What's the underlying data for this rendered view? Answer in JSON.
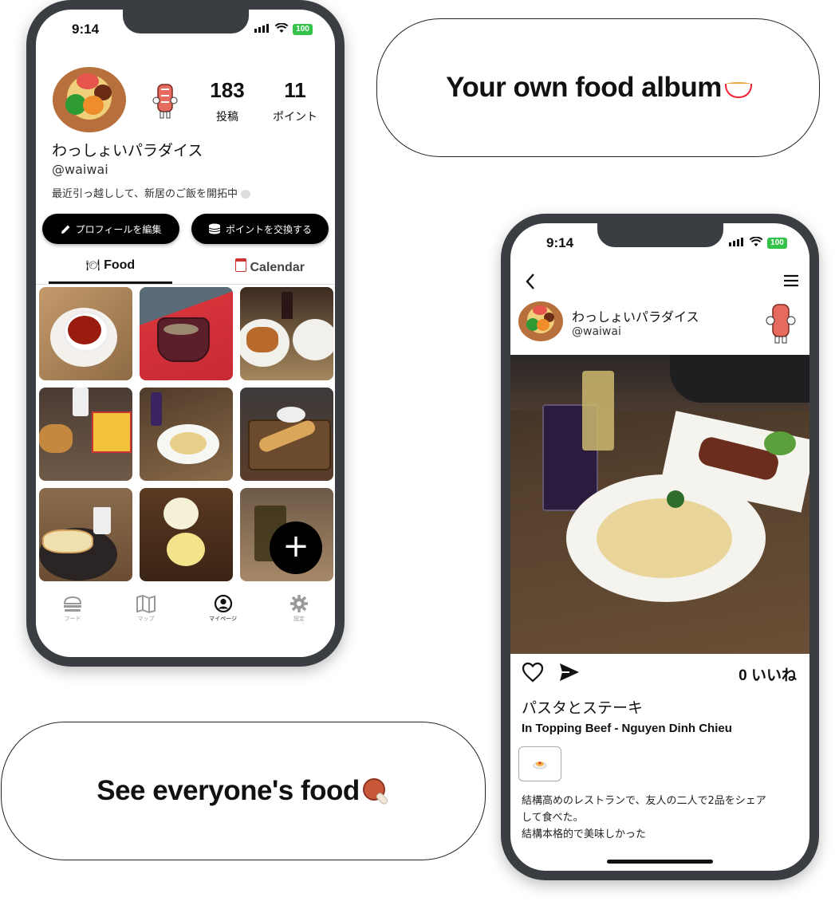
{
  "callouts": {
    "album": "Your own food album",
    "everyone": "See everyone's food"
  },
  "left_phone": {
    "status": {
      "time": "9:14",
      "battery": "100"
    },
    "profile": {
      "posts_count": "183",
      "posts_label": "投稿",
      "points_count": "11",
      "points_label": "ポイント",
      "name": "わっしょいパラダイス",
      "handle": "@waiwai",
      "bio": "最近引っ越しして、新居のご飯を開拓中"
    },
    "buttons": {
      "edit_profile": "プロフィールを編集",
      "exchange_points": "ポイントを交換する"
    },
    "tabs": [
      {
        "label": "Food",
        "icon": "plate-icon",
        "active": true
      },
      {
        "label": "Calendar",
        "icon": "calendar-icon",
        "active": false
      }
    ],
    "grid_items": [
      "tea",
      "coffee-cup",
      "fried-chicken",
      "burger-set",
      "pasta-plate",
      "baguette",
      "sandwich-coffee",
      "rice-balls",
      "iced-drink"
    ],
    "fab_label": "+",
    "nav": [
      {
        "label": "フード",
        "icon": "food-icon",
        "active": false
      },
      {
        "label": "マップ",
        "icon": "map-icon",
        "active": false
      },
      {
        "label": "マイページ",
        "icon": "profile-icon",
        "active": true
      },
      {
        "label": "設定",
        "icon": "gear-icon",
        "active": false
      }
    ]
  },
  "right_phone": {
    "status": {
      "time": "9:14",
      "battery": "100"
    },
    "user": {
      "name": "わっしょいパラダイス",
      "handle": "@waiwai"
    },
    "likes": "0 いいね",
    "title": "パスタとステーキ",
    "location": "In Topping Beef - Nguyen Dinh Chieu",
    "description": "結構高めのレストランで、友人の二人で2品をシェア\nして食べた。\n結構本格的で美味しかった"
  },
  "colors": {
    "phone_frame": "#3a3d42",
    "battery": "#35c24a",
    "black": "#000000"
  }
}
